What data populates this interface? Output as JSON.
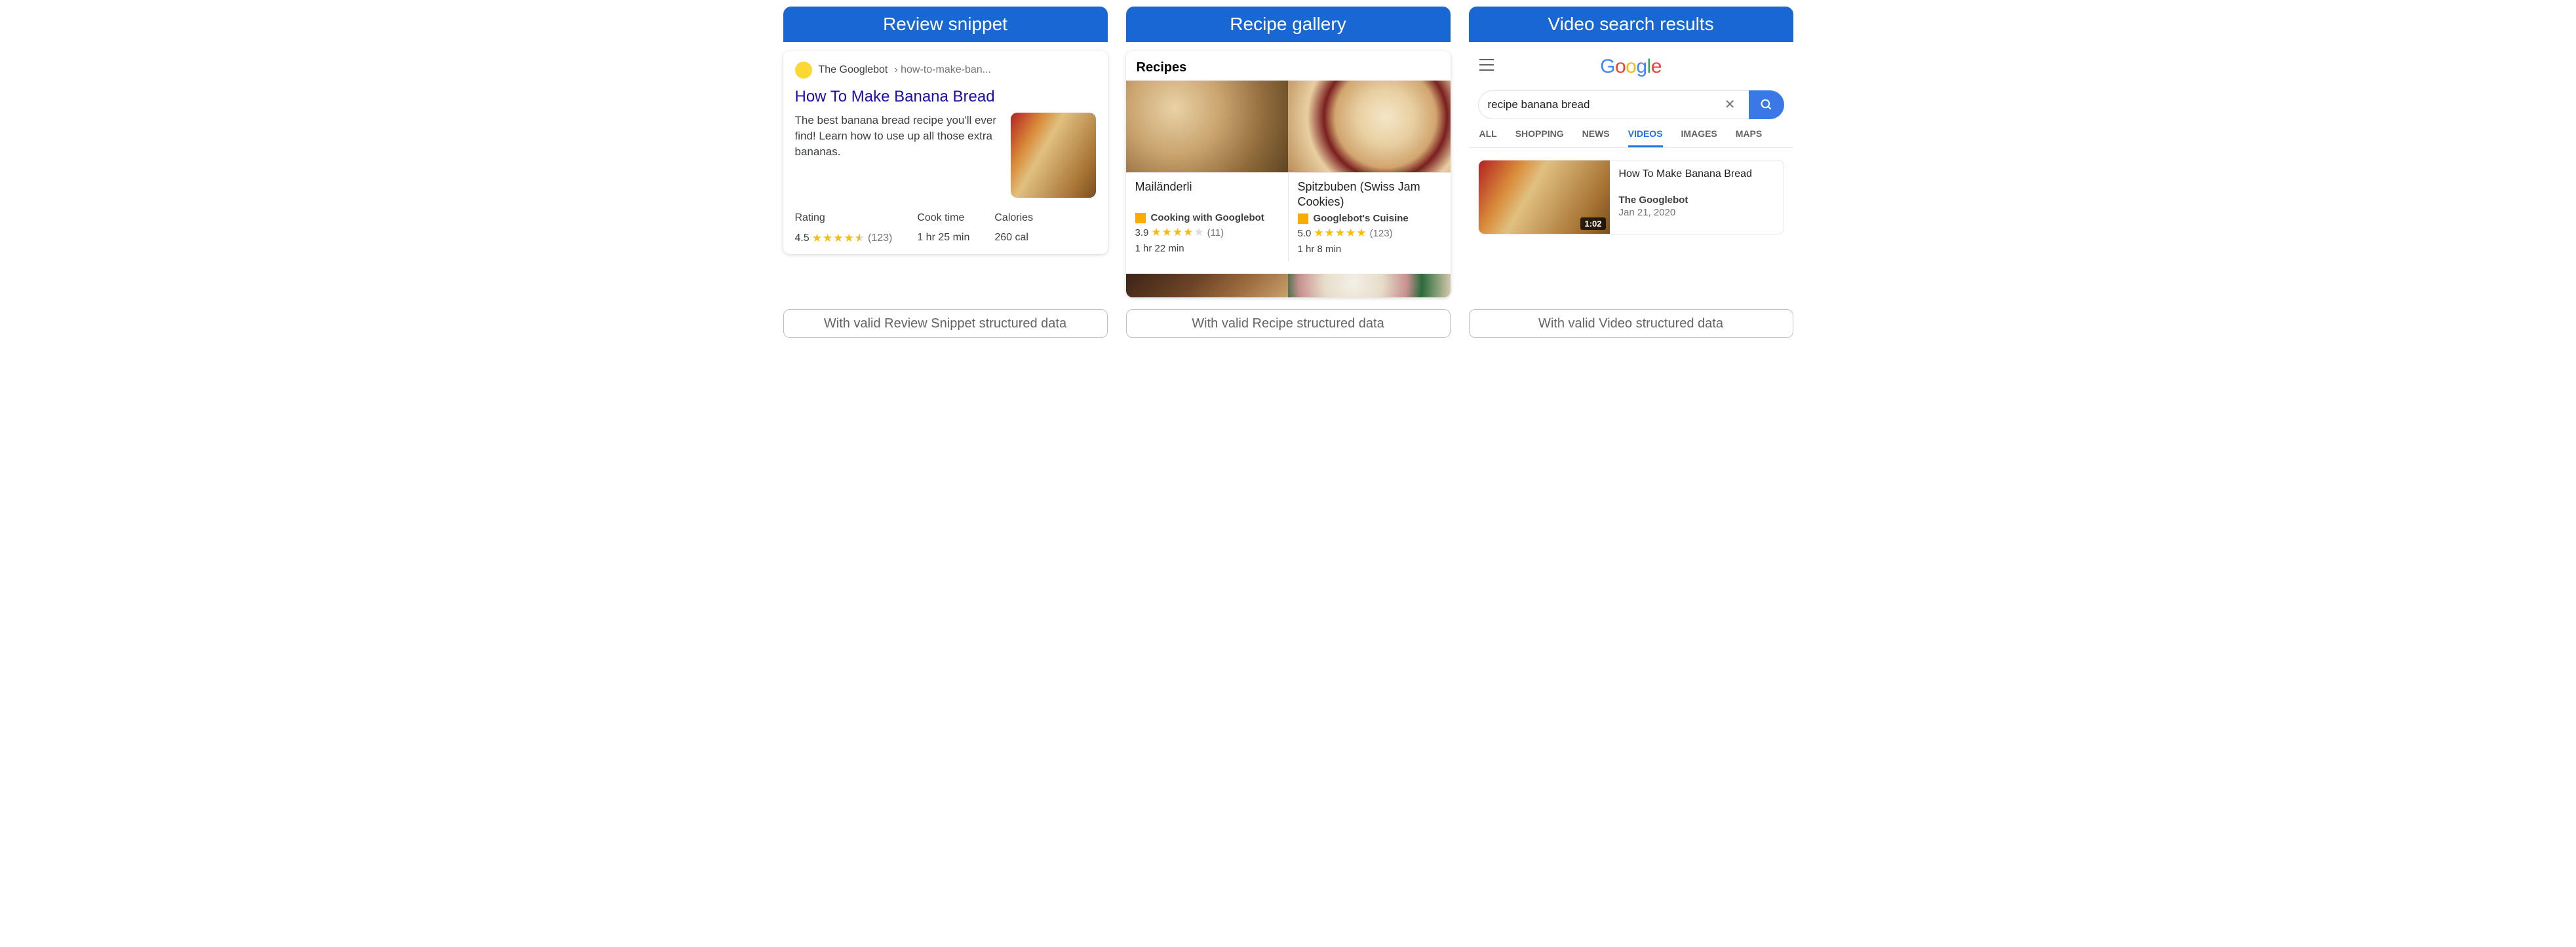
{
  "columns": [
    {
      "header": "Review snippet",
      "footer": "With valid Review Snippet structured data"
    },
    {
      "header": "Recipe gallery",
      "footer": "With valid Recipe structured data"
    },
    {
      "header": "Video search results",
      "footer": "With valid Video structured data"
    }
  ],
  "review": {
    "site": "The Googlebot",
    "crumb": "› how-to-make-ban...",
    "title": "How To Make Banana Bread",
    "description": "The best banana bread recipe you'll ever find! Learn how to use up all those extra bananas.",
    "meta": {
      "rating_label": "Rating",
      "rating_value": "4.5",
      "rating_count": "(123)",
      "cook_label": "Cook time",
      "cook_value": "1 hr 25 min",
      "cal_label": "Calories",
      "cal_value": "260 cal"
    }
  },
  "gallery": {
    "heading": "Recipes",
    "items": [
      {
        "name": "Mailänderli",
        "source": "Cooking with Googlebot",
        "rating": "3.9",
        "count": "(11)",
        "stars_full": 4,
        "time": "1 hr 22 min"
      },
      {
        "name": "Spitzbuben (Swiss Jam Cookies)",
        "source": "Googlebot's Cuisine",
        "rating": "5.0",
        "count": "(123)",
        "stars_full": 5,
        "time": "1 hr 8 min"
      }
    ]
  },
  "video": {
    "query": "recipe banana bread",
    "tabs": [
      "ALL",
      "SHOPPING",
      "NEWS",
      "VIDEOS",
      "IMAGES",
      "MAPS"
    ],
    "active_tab": "VIDEOS",
    "result": {
      "title": "How To Make Banana Bread",
      "publisher": "The Googlebot",
      "date": "Jan 21, 2020",
      "duration": "1:02"
    }
  }
}
